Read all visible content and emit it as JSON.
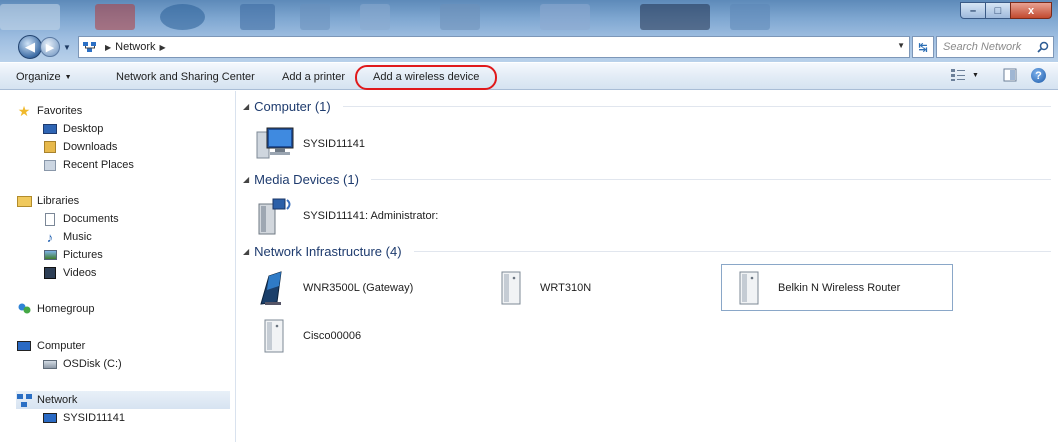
{
  "window": {
    "minimize_label": "–",
    "maximize_label": "□",
    "close_label": "x"
  },
  "address": {
    "breadcrumb": "Network",
    "search_placeholder": "Search Network"
  },
  "toolbar": {
    "organize": "Organize",
    "network_sharing": "Network and Sharing Center",
    "add_printer": "Add a printer",
    "add_wireless": "Add a wireless device"
  },
  "sidebar": {
    "favorites": "Favorites",
    "desktop": "Desktop",
    "downloads": "Downloads",
    "recent": "Recent Places",
    "libraries": "Libraries",
    "documents": "Documents",
    "music": "Music",
    "pictures": "Pictures",
    "videos": "Videos",
    "homegroup": "Homegroup",
    "computer": "Computer",
    "osdisk": "OSDisk (C:)",
    "network": "Network",
    "sysid": "SYSID11141"
  },
  "groups": {
    "computer": {
      "title": "Computer (1)",
      "items": [
        "SYSID11141"
      ]
    },
    "media": {
      "title": "Media Devices (1)",
      "items": [
        "SYSID11141: Administrator:"
      ]
    },
    "infrastructure": {
      "title": "Network Infrastructure (4)",
      "items": [
        "WNR3500L (Gateway)",
        "WRT310N",
        "Belkin N Wireless Router",
        "Cisco00006"
      ]
    }
  },
  "colors": {
    "highlight_ring": "#e0191b",
    "header_text": "#1e3b6e"
  }
}
